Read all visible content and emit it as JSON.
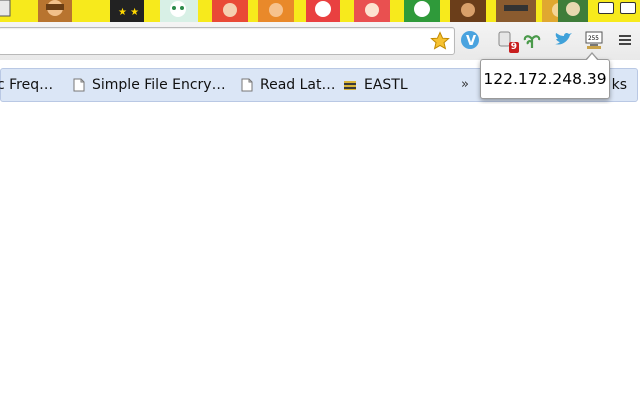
{
  "theme": {
    "background_color": "#f7ea1c"
  },
  "toolbar": {
    "omnibox_value": "",
    "star_icon": "bookmark-star-icon",
    "extensions": [
      {
        "name": "vimeo-extension-icon",
        "color": "#4aa3df"
      },
      {
        "name": "notifier-extension-icon",
        "badge": "9",
        "badge_color": "#c81e1e"
      },
      {
        "name": "plant-extension-icon",
        "color": "#4a9a4a"
      },
      {
        "name": "twitter-bird-extension-icon",
        "color": "#3fa1d9"
      },
      {
        "name": "ip-address-extension-icon"
      }
    ],
    "menu_icon": "hamburger-menu-icon"
  },
  "bookmarks": {
    "items": [
      {
        "label": "c Freq…",
        "icon": "page-icon"
      },
      {
        "label": "Simple File Encry…",
        "icon": "page-icon"
      },
      {
        "label": "Read Lat…",
        "icon": "page-icon"
      },
      {
        "label": "EASTL",
        "icon": "eastl-favicon-icon"
      }
    ],
    "overflow_label": "»",
    "tail_label": "ks"
  },
  "popup": {
    "ip_address": "122.172.248.39"
  }
}
